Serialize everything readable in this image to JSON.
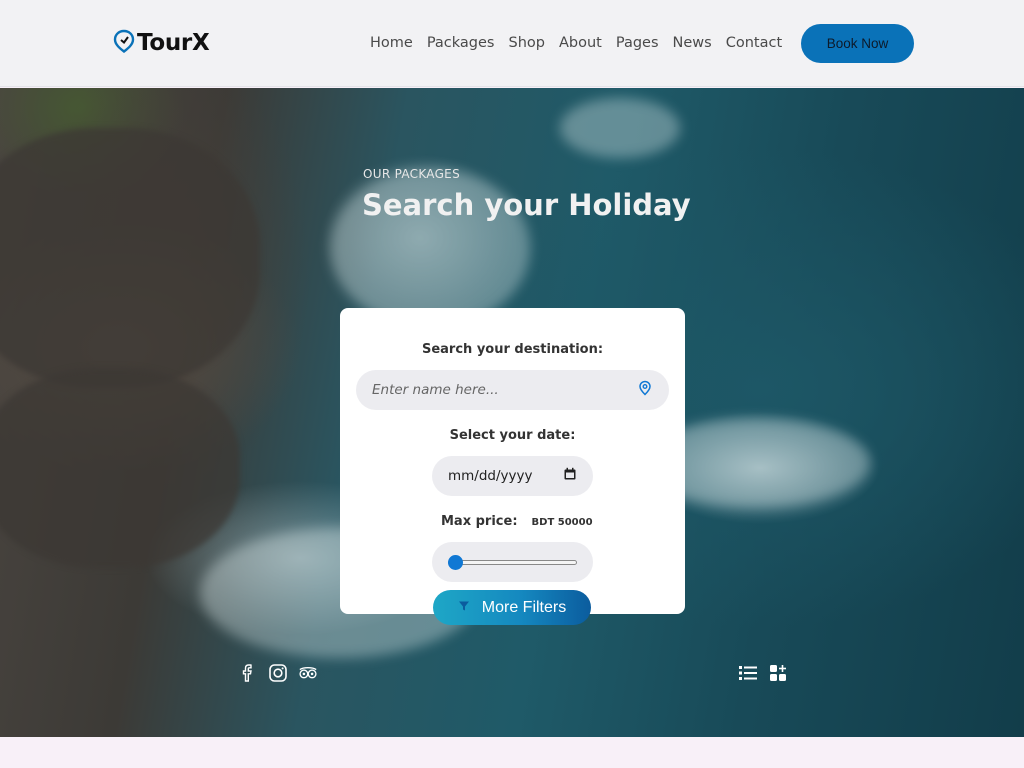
{
  "header": {
    "logo_text": "TourX",
    "nav": [
      "Home",
      "Packages",
      "Shop",
      "About",
      "Pages",
      "News",
      "Contact"
    ],
    "book_label": "Book Now"
  },
  "hero": {
    "kicker": "OUR PACKAGES",
    "title": "Search your Holiday"
  },
  "search": {
    "destination_label": "Search your destination:",
    "destination_placeholder": "Enter name here...",
    "date_label": "Select your date:",
    "date_placeholder": "mm/dd/yyyy",
    "price_label": "Max price:",
    "price_value": "BDT 50000",
    "price_slider_level": 0.0,
    "filters_label": "More Filters"
  },
  "icons": {
    "socials": [
      "facebook-icon",
      "instagram-icon",
      "tripadvisor-icon"
    ],
    "view_toggles": [
      "list-view-icon",
      "grid-view-icon"
    ]
  },
  "colors": {
    "accent": "#0a72b8",
    "filter_gradient_start": "#1ea7c6",
    "filter_gradient_end": "#0b5c9e",
    "slider_thumb": "#1078d4"
  }
}
